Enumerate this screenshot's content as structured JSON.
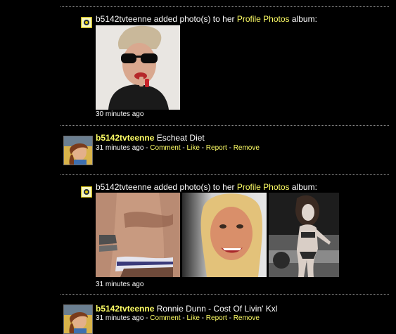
{
  "feed": {
    "entry1": {
      "user": "b5142tvteenne",
      "action": " added photo(s) to her ",
      "album": "Profile Photos",
      "album_suffix": " album:",
      "time": "30 minutes ago",
      "icon": "album-icon"
    },
    "entry2": {
      "user": "b5142tvteenne",
      "status": "Escheat Diet",
      "time": "31 minutes ago",
      "sep": " - ",
      "comment": "Comment",
      "like": "Like",
      "report": "Report",
      "remove": "Remove"
    },
    "entry3": {
      "user": "b5142tvteenne",
      "action": " added photo(s) to her ",
      "album": "Profile Photos",
      "album_suffix": " album:",
      "time": "31 minutes ago",
      "icon": "album-icon"
    },
    "entry4": {
      "user": "b5142tvteenne",
      "status": "Ronnie Dunn - Cost Of Livin' Kxl",
      "time": "31 minutes ago",
      "sep": " - ",
      "comment": "Comment",
      "like": "Like",
      "report": "Report",
      "remove": "Remove"
    }
  },
  "colors": {
    "background": "#000000",
    "link": "#ffff66",
    "text": "#ffffff",
    "divider": "#8a8a8a"
  }
}
